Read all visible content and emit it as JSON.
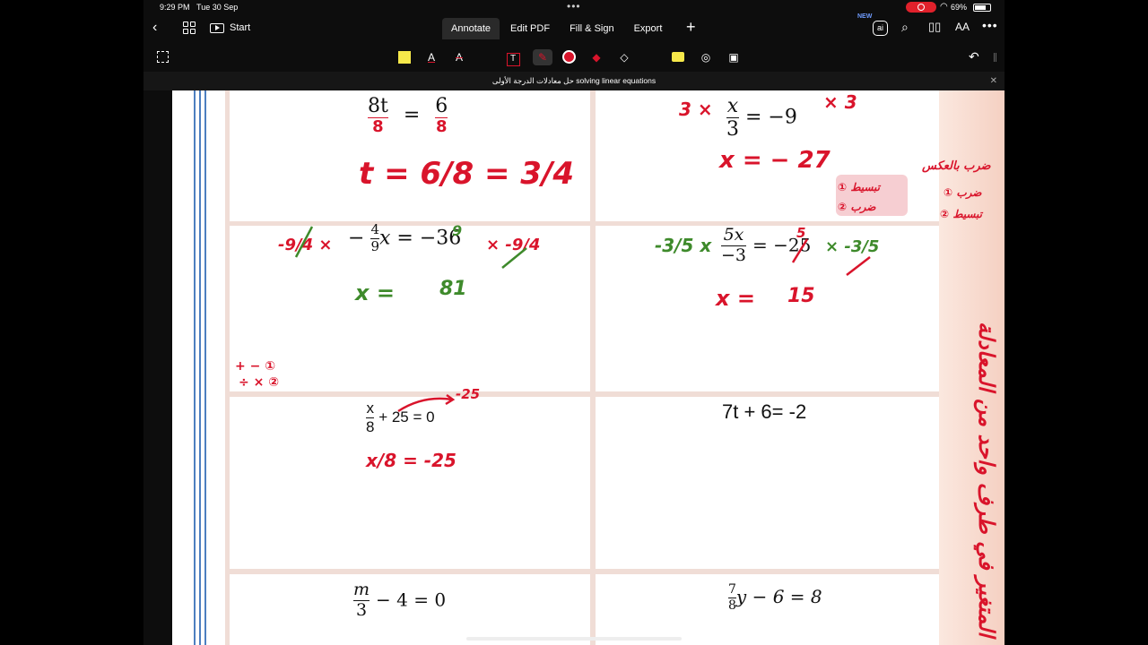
{
  "status": {
    "time": "9:29 PM",
    "date": "Tue 30 Sep",
    "battery": "69%"
  },
  "topbar": {
    "start_label": "Start",
    "tabs": [
      "Annotate",
      "Edit PDF",
      "Fill & Sign",
      "Export"
    ],
    "new_badge": "NEW",
    "ai_label": "ai"
  },
  "annotation_tools": [
    "select",
    "highlighter",
    "text-color",
    "strike-text",
    "text-box",
    "pen",
    "color-red",
    "eraser-fill",
    "eraser",
    "comment",
    "shapes",
    "stamp"
  ],
  "colors": {
    "accent_red": "#d9142b",
    "green": "#3e8a2b",
    "rail_blue": "#4d7fc0",
    "toolbar_bg": "#0d0d0d"
  },
  "document": {
    "title": "حل معادلات الدرجة الأولى solving linear equations"
  },
  "worksheet": {
    "cells": [
      {
        "id": "c1",
        "numerator_left": "8t",
        "eq": "=",
        "numerator_right": "6"
      },
      {
        "id": "c2",
        "numerator": "x",
        "denominator": "3",
        "rhs": "= −9"
      },
      {
        "id": "c3",
        "numerator": "4",
        "denominator": "9",
        "lhs_sign": "−",
        "var": "x",
        "rhs": "= −36"
      },
      {
        "id": "c4",
        "numerator": "5x",
        "denominator": "−3",
        "rhs": "= −25"
      },
      {
        "id": "c5",
        "numerator": "x",
        "denominator": "8",
        "rest": "+ 25 = 0"
      },
      {
        "id": "c6",
        "text": "7t + 6= -2"
      },
      {
        "id": "c7",
        "numerator": "m",
        "denominator": "3",
        "rest": "− 4 = 0"
      },
      {
        "id": "c8",
        "numerator": "7",
        "denominator": "8",
        "rest": "y − 6 = 8"
      }
    ],
    "handwriting": {
      "c1_line2": "t = 6/8 = 3/4",
      "c2_mult": "3 ×",
      "c2_right": "× 3",
      "c2_answer": "x = − 27",
      "c3_left": "-9/4 ×",
      "c3_right": "× -9/4",
      "c3_top": "9",
      "c3_answer_lhs": "x =",
      "c3_answer_rhs": "81",
      "c4_left": "-3/5 x",
      "c4_right": "× -3/5",
      "c4_top": "5",
      "c4_answer_lhs": "x =",
      "c4_answer_rhs": "15",
      "c5_arrow": "-25",
      "c5_line2": "x/8 = -25",
      "margin_note": "+ − ①\n÷ × ②",
      "side_arabic_top": "ضرب بالعكس\n① ضرب\n② تبسيط",
      "side_arabic_highlight": "① تبسيط\n② ضرب",
      "strip_arabic": "المتغير في طرف واحد من المعادلة"
    }
  }
}
